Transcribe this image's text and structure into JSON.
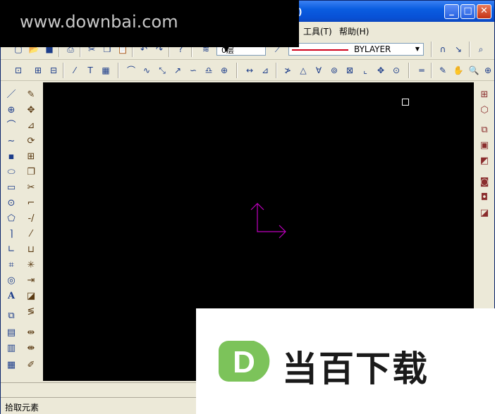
{
  "window": {
    "title_fragment": "版)",
    "caption_buttons": {
      "minimize": "_",
      "maximize": "□",
      "close": "✕"
    }
  },
  "watermark": {
    "site": "www.downbai.com",
    "brand_letter": "D",
    "brand_text": "当百下载"
  },
  "menu": {
    "items": [
      {
        "label": "工具(T)"
      },
      {
        "label": "帮助(H)"
      }
    ]
  },
  "toolbar_layers": {
    "layer_value": "0层",
    "linetype_value": "BYLAYER",
    "linetype_color": "#d0001a"
  },
  "toolbar1_icons": [
    "new-icon",
    "open-icon",
    "save-icon",
    "print-icon",
    "cut-icon",
    "copy-icon",
    "paste-icon",
    "undo-icon",
    "redo-icon",
    "help-icon",
    "layer-manager-icon",
    "layer-state-icon",
    "linetype-icon",
    "u-icon",
    "pick-icon",
    "zoom-window-icon"
  ],
  "toolbar2_icons": [
    "snap-icon",
    "grid-icon",
    "ortho-icon",
    "osnap-icon",
    "text-icon",
    "hatch-icon",
    "arc-icon",
    "spline-icon",
    "trim-icon",
    "extend-icon",
    "break-icon",
    "chamfer-icon",
    "dimension-icon",
    "angular-icon",
    "leader-icon",
    "radius-icon",
    "diameter-icon",
    "center-icon",
    "ordinate-icon",
    "tolerance-icon",
    "measure-icon",
    "pencil-icon",
    "pan-icon",
    "zoom-icon",
    "zoom-extents-icon"
  ],
  "draw_palette_icons": [
    "line-icon",
    "circle-icon",
    "arc-icon",
    "spline-icon",
    "rectangle-icon",
    "ellipse-icon",
    "block-icon",
    "point-icon",
    "polygon-icon",
    "polyline-icon",
    "ray-icon",
    "hatch-icon",
    "region-icon",
    "text-icon",
    "insert-icon",
    "table-icon",
    "attribute-icon"
  ],
  "modify_palette_icons": [
    "erase-icon",
    "move-icon",
    "mirror-icon",
    "rotate-icon",
    "array-icon",
    "copy-icon",
    "trim-icon",
    "fillet-icon",
    "break-icon",
    "extend-icon",
    "stretch-icon",
    "explode-icon",
    "scale-icon",
    "lengthen-icon",
    "offset-icon",
    "join-icon",
    "match-icon",
    "edit-icon"
  ],
  "right_palette_icons": [
    "properties-icon",
    "view-3d-icon",
    "layer-icon",
    "block-editor-icon",
    "xref-icon",
    "camera-icon",
    "render-icon",
    "design-center-icon"
  ],
  "canvas": {
    "background": "#000000",
    "ucs_color": "#c000c0"
  },
  "status": {
    "text": "拾取元素"
  }
}
